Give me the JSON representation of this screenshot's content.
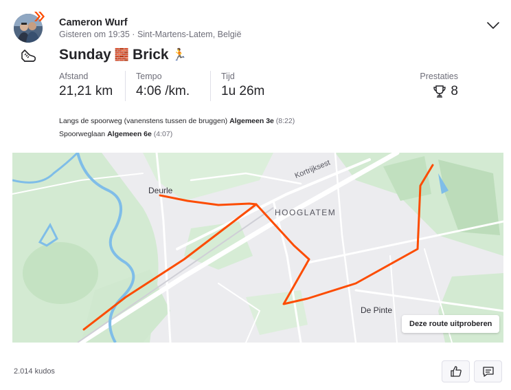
{
  "athlete": {
    "name": "Cameron Wurf",
    "meta": "Gisteren om 19:35 · Sint-Martens-Latem, België"
  },
  "activity": {
    "title_part1": "Sunday",
    "emoji1": "🧱",
    "title_part2": "Brick",
    "emoji2": "🏃"
  },
  "stats": [
    {
      "label": "Afstand",
      "value": "21,21 km"
    },
    {
      "label": "Tempo",
      "value": "4:06 /km."
    },
    {
      "label": "Tijd",
      "value": "1u 26m"
    }
  ],
  "achievements": {
    "label": "Prestaties",
    "value": "8"
  },
  "segments": [
    {
      "name": "Langs de spoorweg (vanenstens tussen de bruggen)",
      "rank": "Algemeen 3e",
      "time": "(8:22)"
    },
    {
      "name": "Spoorweglaan",
      "rank": "Algemeen 6e",
      "time": "(4:07)"
    }
  ],
  "map": {
    "labels": {
      "deurle": "Deurle",
      "hooglatem": "HOOGLATEM",
      "de_pinte": "De Pinte",
      "kortrijksesteenweg": "Kortrijksest"
    },
    "route_button": "Deze route uitproberen",
    "route_color": "#fc4c02",
    "water_color": "#7fbde8",
    "park_color": "#c8e6c9"
  },
  "footer": {
    "kudos": "2.014 kudos"
  },
  "icons": {
    "sport": "running-shoe-icon",
    "chevron": "chevron-down-icon",
    "trophy": "trophy-icon",
    "kudos": "thumbs-up-icon",
    "comment": "comment-icon"
  },
  "colors": {
    "brand": "#fc4c02",
    "text": "#242428",
    "muted": "#6d6d78"
  }
}
